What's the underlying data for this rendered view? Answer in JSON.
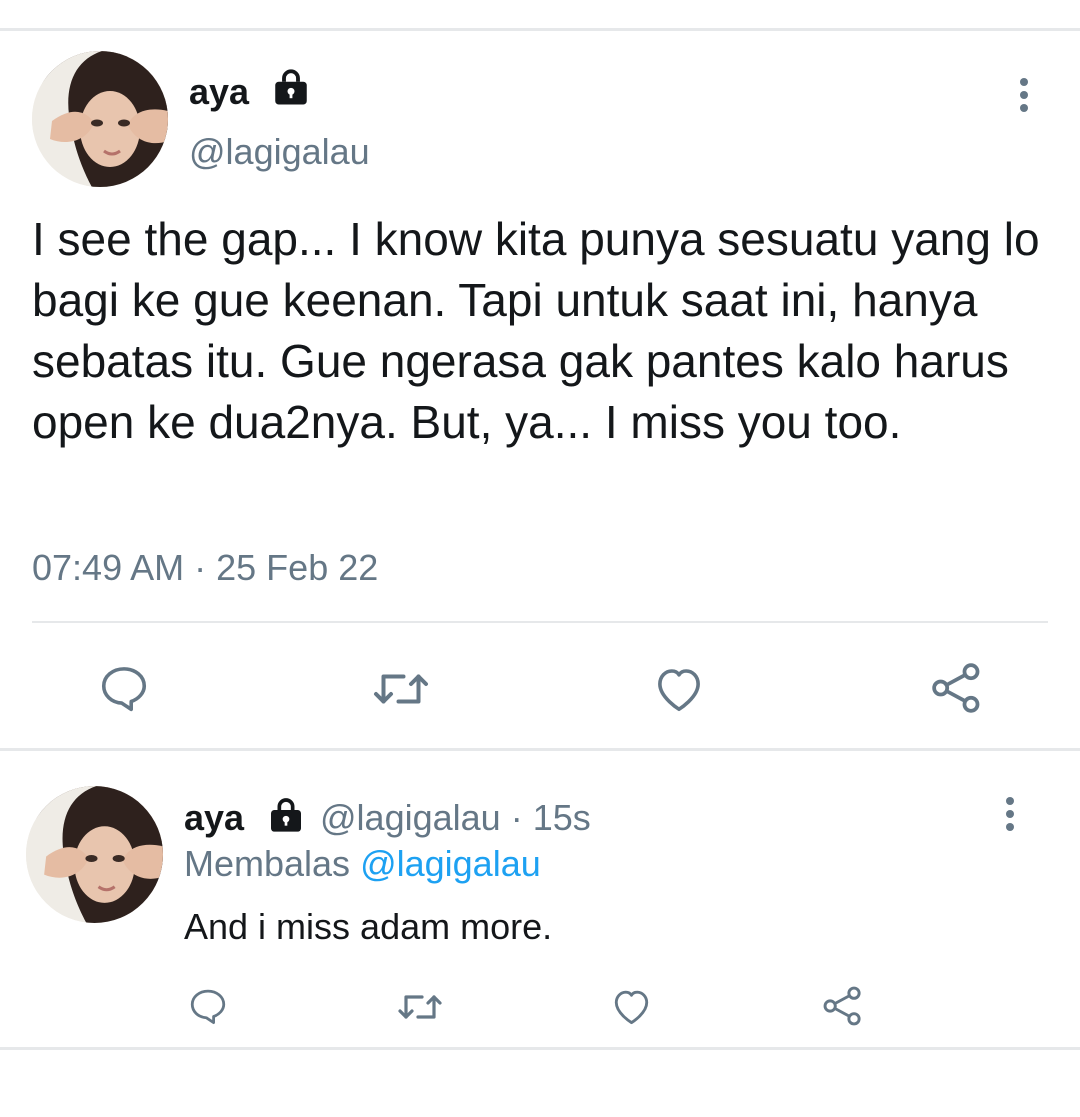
{
  "main_tweet": {
    "display_name": "aya",
    "handle": "@lagigalau",
    "text": "I see the gap... I know kita punya sesuatu yang lo bagi ke gue keenan. Tapi untuk saat ini, hanya sebatas itu. Gue ngerasa gak pantes kalo harus open ke dua2nya. But, ya... I miss you too.",
    "time": "07:49 AM",
    "separator": "·",
    "date": "25 Feb 22",
    "actions": [
      "reply-icon",
      "retweet-icon",
      "like-icon",
      "share-icon"
    ]
  },
  "reply_tweet": {
    "display_name": "aya",
    "handle": "@lagigalau",
    "separator": "·",
    "age": "15s",
    "replying_label": "Membalas",
    "replying_to": "@lagigalau",
    "text": "And i miss adam more.",
    "actions": [
      "reply-icon",
      "retweet-icon",
      "like-icon",
      "share-icon"
    ]
  },
  "colors": {
    "text": "#14171a",
    "secondary": "#657786",
    "link": "#1da1f2",
    "divider": "#e6e8ea"
  }
}
